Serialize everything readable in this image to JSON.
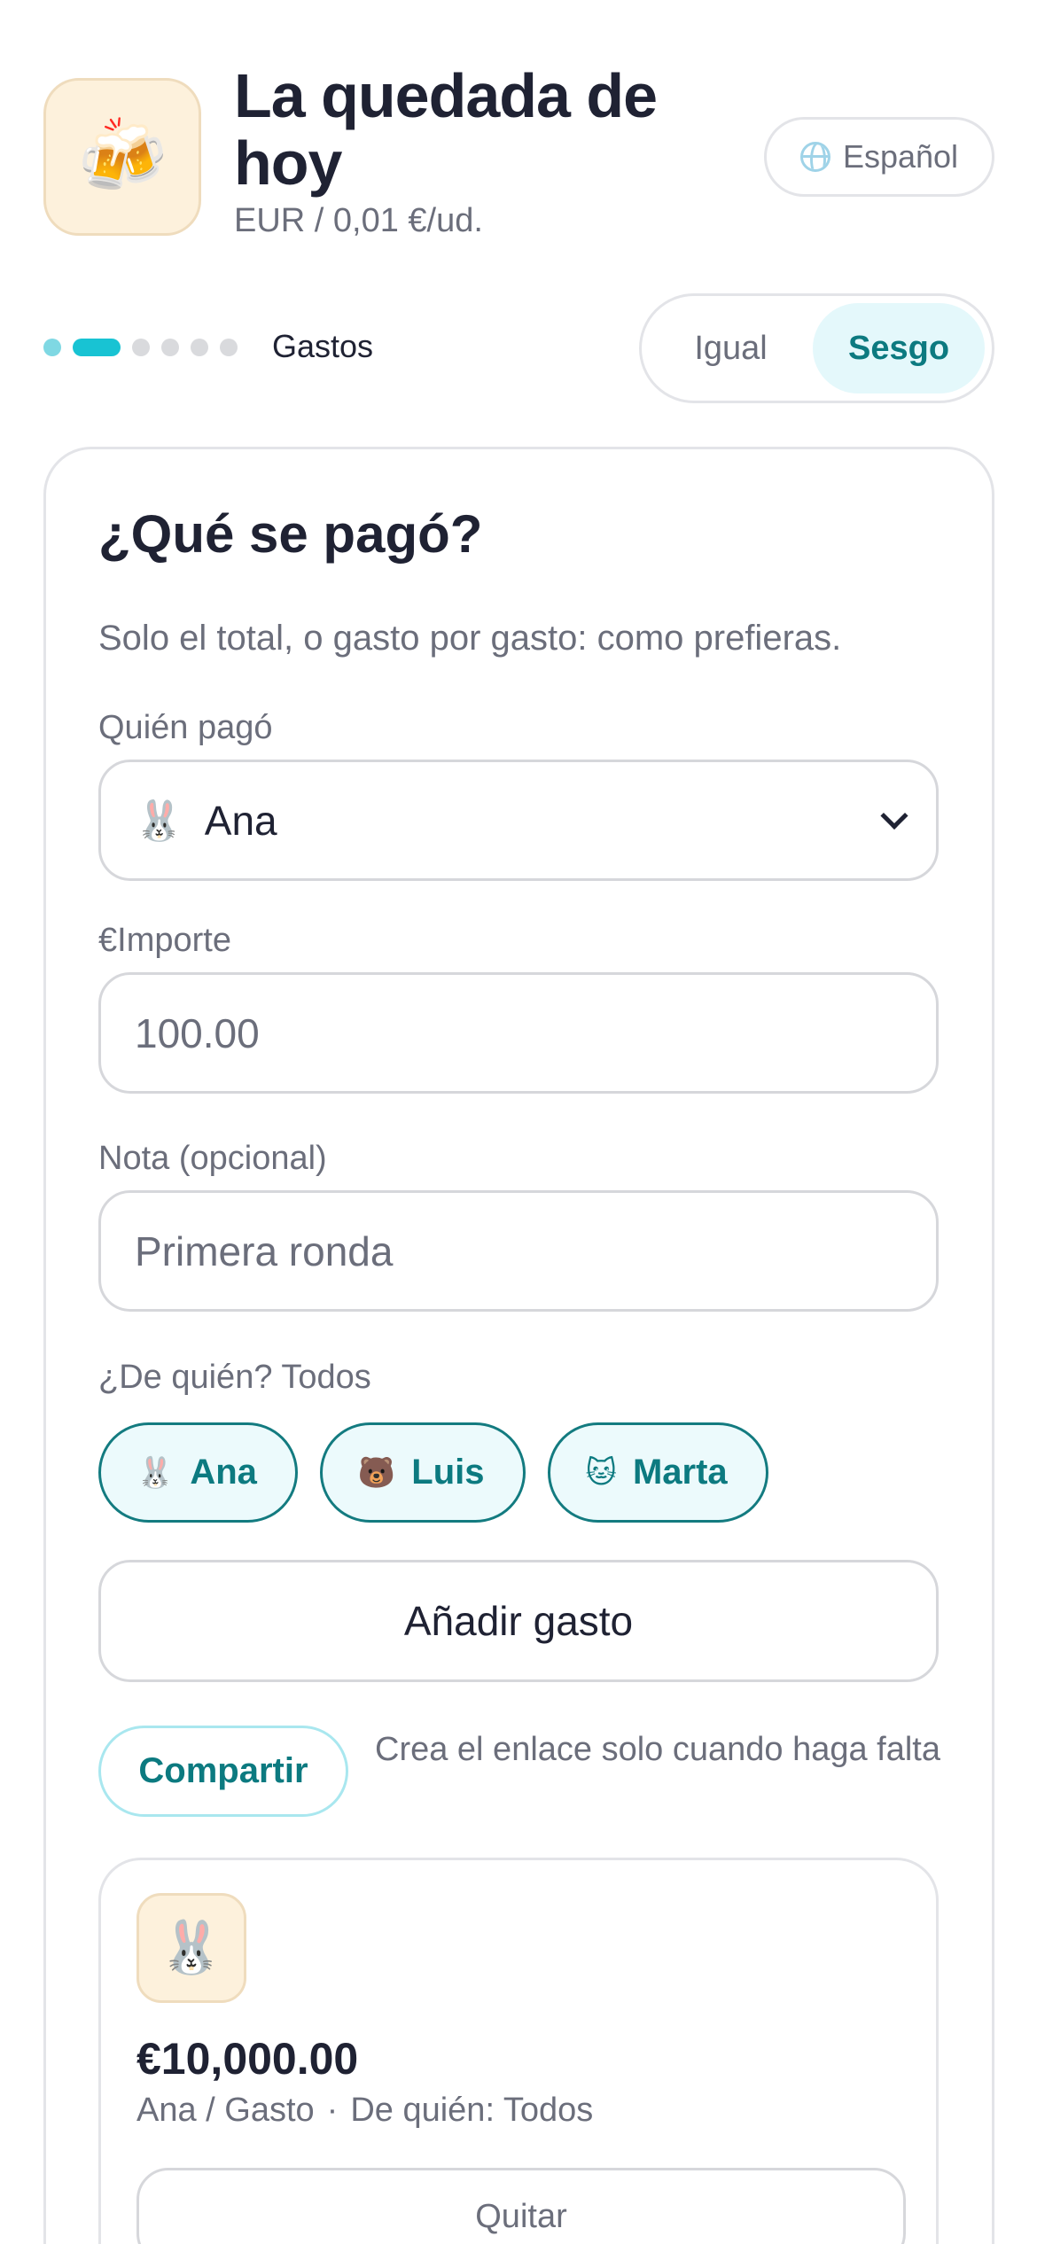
{
  "header": {
    "icon": "beer-mugs-icon",
    "icon_glyph": "🍻",
    "title": "La quedada de hoy",
    "subtitle": "EUR / 0,01 €/ud.",
    "language_label": "Español"
  },
  "progress": {
    "total_steps": 6,
    "current_step": 2,
    "step_label": "Gastos"
  },
  "split_toggle": {
    "options": [
      "Igual",
      "Sesgo"
    ],
    "selected": "Sesgo"
  },
  "form": {
    "title": "¿Qué se pagó?",
    "description": "Solo el total, o gasto por gasto: como prefieras.",
    "payer_label": "Quién pagó",
    "payer_value": "Ana",
    "payer_emoji": "🐰",
    "amount_label": "€Importe",
    "amount_placeholder": "100.00",
    "note_label": "Nota (opcional)",
    "note_placeholder": "Primera ronda",
    "for_whom_label": "¿De quién? Todos",
    "participants": [
      {
        "name": "Ana",
        "emoji": "🐰"
      },
      {
        "name": "Luis",
        "emoji": "🐻"
      },
      {
        "name": "Marta",
        "emoji": "🐱"
      }
    ],
    "add_button": "Añadir gasto",
    "share_button": "Compartir",
    "share_hint": "Crea el enlace solo cuando haga falta"
  },
  "expenses": [
    {
      "avatar_emoji": "🐰",
      "amount": "€10,000.00",
      "payer_type": "Ana / Gasto",
      "separator": "·",
      "for_whom": "De quién: Todos",
      "remove_label": "Quitar"
    }
  ],
  "colors": {
    "accent": "#18c3d3",
    "accent_dark": "#0c7a80",
    "accent_bg": "#e4f8fb",
    "text": "#1f2233",
    "muted": "#6b6e7b"
  }
}
